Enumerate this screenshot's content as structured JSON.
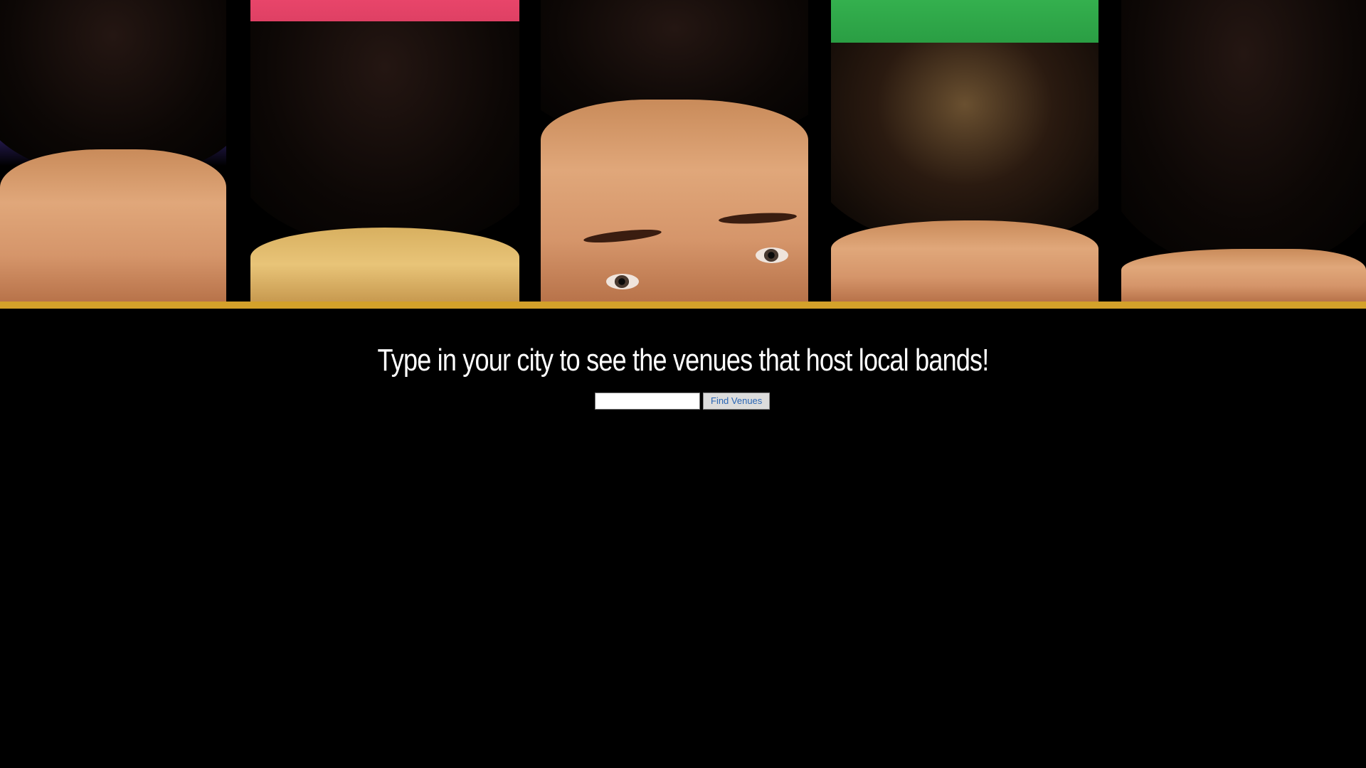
{
  "banner": {
    "panel_colors": [
      "#5b3fb8",
      "#e8456a",
      "#f0b31a",
      "#34b04e",
      "#2aa7e0"
    ],
    "accent_bar_color": "#d4a12a"
  },
  "main": {
    "headline": "Type in your city to see the venues that host local bands!",
    "search": {
      "input_value": "",
      "input_placeholder": "",
      "button_label": "Find Venues"
    }
  }
}
